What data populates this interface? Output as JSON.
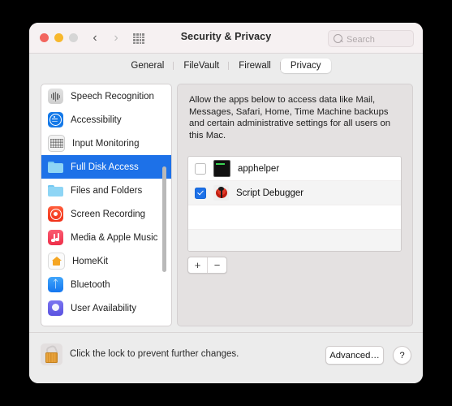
{
  "window": {
    "title": "Security & Privacy",
    "traffic_lights": [
      "close",
      "minimize",
      "zoom"
    ],
    "nav": {
      "back": "‹",
      "forward": "›"
    },
    "grid_icon": "apps-grid-icon"
  },
  "search": {
    "placeholder": "Search",
    "value": ""
  },
  "tabs": [
    {
      "label": "General",
      "active": false
    },
    {
      "label": "FileVault",
      "active": false
    },
    {
      "label": "Firewall",
      "active": false
    },
    {
      "label": "Privacy",
      "active": true
    }
  ],
  "sidebar": {
    "items": [
      {
        "label": "Speech Recognition",
        "icon": "speech-recognition-icon",
        "selected": false
      },
      {
        "label": "Accessibility",
        "icon": "accessibility-icon",
        "selected": false
      },
      {
        "label": "Input Monitoring",
        "icon": "keyboard-icon",
        "selected": false
      },
      {
        "label": "Full Disk Access",
        "icon": "folder-icon",
        "selected": true
      },
      {
        "label": "Files and Folders",
        "icon": "folder-icon",
        "selected": false
      },
      {
        "label": "Screen Recording",
        "icon": "screen-recording-icon",
        "selected": false
      },
      {
        "label": "Media & Apple Music",
        "icon": "music-note-icon",
        "selected": false
      },
      {
        "label": "HomeKit",
        "icon": "homekit-house-icon",
        "selected": false
      },
      {
        "label": "Bluetooth",
        "icon": "bluetooth-icon",
        "selected": false
      },
      {
        "label": "User Availability",
        "icon": "user-availability-icon",
        "selected": false
      }
    ]
  },
  "detail": {
    "description": "Allow the apps below to access data like Mail, Messages, Safari, Home, Time Machine backups and certain administrative settings for all users on this Mac.",
    "apps": [
      {
        "name": "apphelper",
        "checked": false,
        "icon": "terminal-icon"
      },
      {
        "name": "Script Debugger",
        "checked": true,
        "icon": "ladybug-icon"
      }
    ],
    "add_label": "+",
    "remove_label": "−"
  },
  "bottom": {
    "lock_icon": "unlocked-padlock-icon",
    "lock_text": "Click the lock to prevent further changes.",
    "advanced_label": "Advanced…",
    "help_label": "?"
  },
  "colors": {
    "accent": "#1d71e8",
    "window_bg": "#ececec",
    "titlebar_bg": "#f6f1f2",
    "panel_bg": "#e4e1e1"
  }
}
